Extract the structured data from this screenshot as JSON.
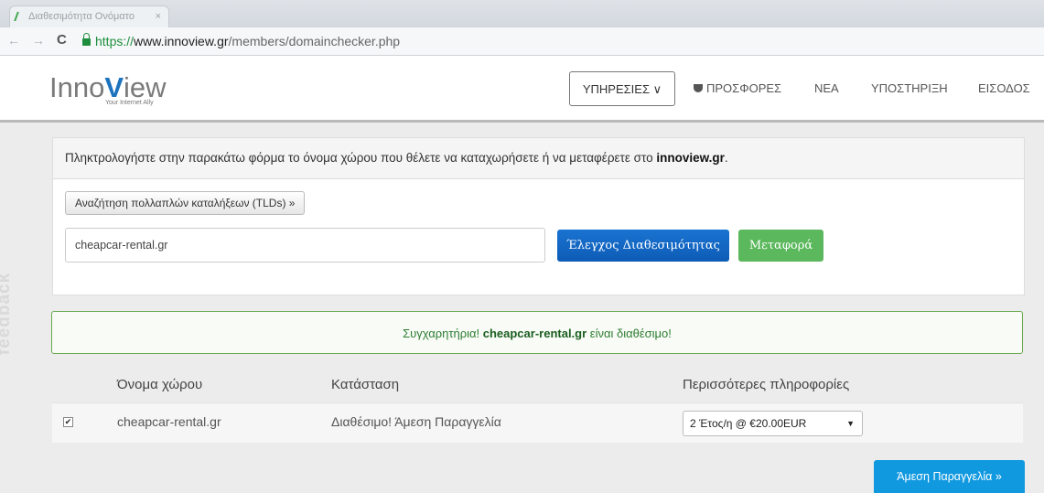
{
  "browser": {
    "tab_title": "Διαθεσιμότητα Ονόματο",
    "url_scheme": "https://",
    "url_host": "www.innoview.gr",
    "url_path": "/members/domainchecker.php"
  },
  "header": {
    "logo_prefix": "Inno",
    "logo_v": "V",
    "logo_suffix": "iew",
    "logo_tagline": "Your Internet Ally",
    "nav": {
      "services": "ΥΠΗΡΕΣΙΕΣ",
      "offers": "ΠΡΟΣΦΟΡΕΣ",
      "news": "ΝΕΑ",
      "support": "ΥΠΟΣΤΗΡΙΞΗ",
      "login": "ΕΙΣΟΔΟΣ"
    }
  },
  "checker": {
    "intro": "Πληκτρολογήστε στην παρακάτω φόρμα το όνομα χώρου που θέλετε να καταχωρήσετε ή να μεταφέρετε στο ",
    "intro_site": "innoview.gr",
    "intro_end": ".",
    "tld_button": "Αναζήτηση πολλαπλών καταλήξεων (TLDs) »",
    "domain_value": "cheapcar-rental.gr",
    "check_button": "Έλεγχος Διαθεσιμότητας",
    "transfer_button": "Μεταφορά"
  },
  "result": {
    "prefix": "Συγχαρητήρια! ",
    "domain": "cheapcar-rental.gr",
    "suffix": " είναι διαθέσιμο!"
  },
  "table": {
    "headers": [
      "Όνομα χώρου",
      "Κατάσταση",
      "Περισσότερες πληροφορίες"
    ],
    "row": {
      "checked": true,
      "domain": "cheapcar-rental.gr",
      "status": "Διαθέσιμο! Άμεση Παραγγελία",
      "period": "2 Έτος/η @ €20.00EUR"
    }
  },
  "order_button": "Άμεση Παραγγελία »",
  "feedback_tab": "feedback"
}
